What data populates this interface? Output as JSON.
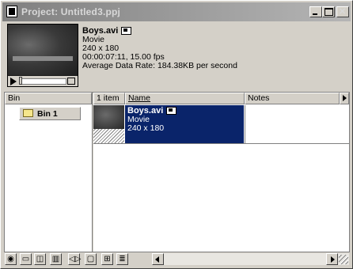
{
  "window": {
    "title": "Project: Untitled3.ppj"
  },
  "preview": {
    "clip_name": "Boys.avi",
    "type": "Movie",
    "dimensions": "240 x 180",
    "timing": "00:00:07:11, 15.00 fps",
    "data_rate": "Average Data Rate: 184.38KB per second"
  },
  "columns": {
    "bin": "Bin",
    "count": "1 item",
    "name": "Name",
    "notes": "Notes"
  },
  "bins": [
    {
      "label": "Bin 1"
    }
  ],
  "items": [
    {
      "name": "Boys.avi",
      "type": "Movie",
      "dimensions": "240 x 180"
    }
  ],
  "toolbar": {
    "icons": [
      "binoculars-icon",
      "new-bin-icon",
      "new-item-icon",
      "trash-icon",
      "rate-icon",
      "thumbnail-view-icon",
      "icon-view-icon",
      "list-view-icon"
    ]
  }
}
